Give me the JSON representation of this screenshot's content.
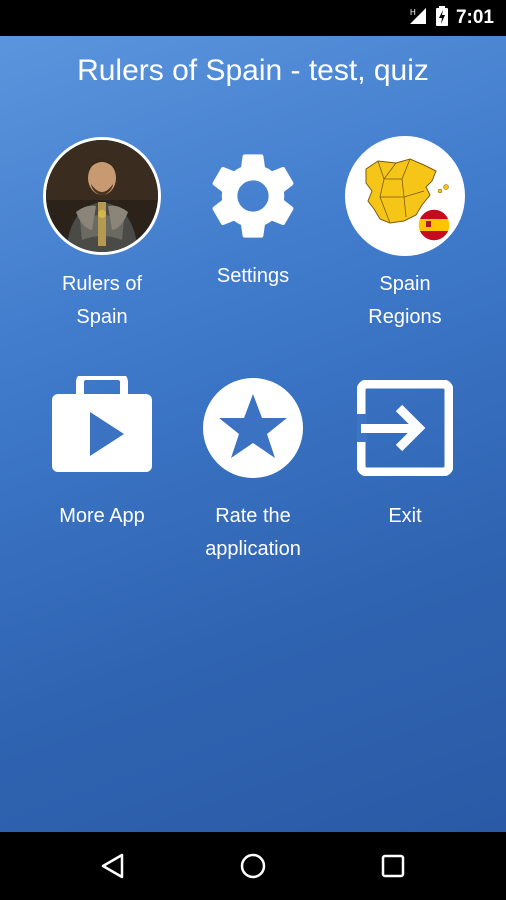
{
  "status_bar": {
    "time": "7:01",
    "icons": [
      "signal-icon",
      "battery-charging-icon"
    ]
  },
  "app": {
    "title": "Rulers of Spain - test, quiz"
  },
  "menu": {
    "items": [
      {
        "label": "Rulers of\nSpain",
        "icon": "ruler-portrait-icon"
      },
      {
        "label": "Settings",
        "icon": "gear-icon"
      },
      {
        "label": "Spain\nRegions",
        "icon": "spain-map-icon"
      },
      {
        "label": "More App",
        "icon": "play-store-icon"
      },
      {
        "label": "Rate the\napplication",
        "icon": "star-icon"
      },
      {
        "label": "Exit",
        "icon": "exit-icon"
      }
    ]
  },
  "nav_bar": {
    "buttons": [
      "back-icon",
      "home-icon",
      "recents-icon"
    ]
  },
  "colors": {
    "background_top": "#5b95dd",
    "background_bottom": "#2a5aa6",
    "map_yellow": "#f5c518",
    "flag_red": "#c60b1e"
  }
}
